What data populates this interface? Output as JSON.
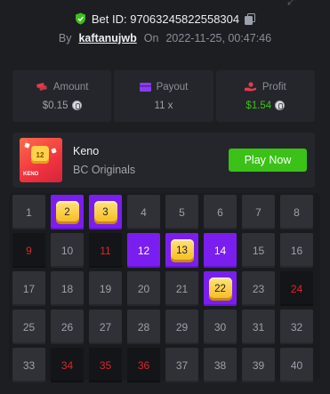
{
  "header": {
    "bet_id_label": "Bet ID: 97063245822558304",
    "by_label": "By",
    "username": "kaftanujwb",
    "on_label": "On",
    "datetime": "2022-11-25, 00:47:46"
  },
  "stats": [
    {
      "label": "Amount",
      "value": "$0.15",
      "color": "#e23b4e"
    },
    {
      "label": "Payout",
      "value": "11 x",
      "color": "#8a3cf0"
    },
    {
      "label": "Profit",
      "value": "$1.54",
      "color": "#e23b4e"
    }
  ],
  "game": {
    "thumb_number": "12",
    "thumb_label": "KENO",
    "name": "Keno",
    "provider": "BC Originals",
    "play_label": "Play Now"
  },
  "board": {
    "cells": [
      {
        "n": "1",
        "s": "normal"
      },
      {
        "n": "2",
        "s": "hit"
      },
      {
        "n": "3",
        "s": "hit"
      },
      {
        "n": "4",
        "s": "normal"
      },
      {
        "n": "5",
        "s": "normal"
      },
      {
        "n": "6",
        "s": "normal"
      },
      {
        "n": "7",
        "s": "normal"
      },
      {
        "n": "8",
        "s": "normal"
      },
      {
        "n": "9",
        "s": "miss"
      },
      {
        "n": "10",
        "s": "normal"
      },
      {
        "n": "11",
        "s": "miss"
      },
      {
        "n": "12",
        "s": "pick"
      },
      {
        "n": "13",
        "s": "hit"
      },
      {
        "n": "14",
        "s": "pick"
      },
      {
        "n": "15",
        "s": "normal"
      },
      {
        "n": "16",
        "s": "normal"
      },
      {
        "n": "17",
        "s": "normal"
      },
      {
        "n": "18",
        "s": "normal"
      },
      {
        "n": "19",
        "s": "normal"
      },
      {
        "n": "20",
        "s": "normal"
      },
      {
        "n": "21",
        "s": "normal"
      },
      {
        "n": "22",
        "s": "hit"
      },
      {
        "n": "23",
        "s": "normal"
      },
      {
        "n": "24",
        "s": "miss"
      },
      {
        "n": "25",
        "s": "normal"
      },
      {
        "n": "26",
        "s": "normal"
      },
      {
        "n": "27",
        "s": "normal"
      },
      {
        "n": "28",
        "s": "normal"
      },
      {
        "n": "29",
        "s": "normal"
      },
      {
        "n": "30",
        "s": "normal"
      },
      {
        "n": "31",
        "s": "normal"
      },
      {
        "n": "32",
        "s": "normal"
      },
      {
        "n": "33",
        "s": "normal"
      },
      {
        "n": "34",
        "s": "miss"
      },
      {
        "n": "35",
        "s": "miss"
      },
      {
        "n": "36",
        "s": "miss"
      },
      {
        "n": "37",
        "s": "normal"
      },
      {
        "n": "38",
        "s": "normal"
      },
      {
        "n": "39",
        "s": "normal"
      },
      {
        "n": "40",
        "s": "normal"
      }
    ]
  },
  "colors": {
    "accent_green": "#3bc117",
    "pick_purple": "#7a1ef0",
    "miss_red": "#d8262f",
    "background": "#1c1e22"
  },
  "icons": [
    "shield-check-icon",
    "copy-icon",
    "expand-icon",
    "money-icon",
    "card-icon",
    "profit-hand-icon",
    "coin-icon"
  ]
}
